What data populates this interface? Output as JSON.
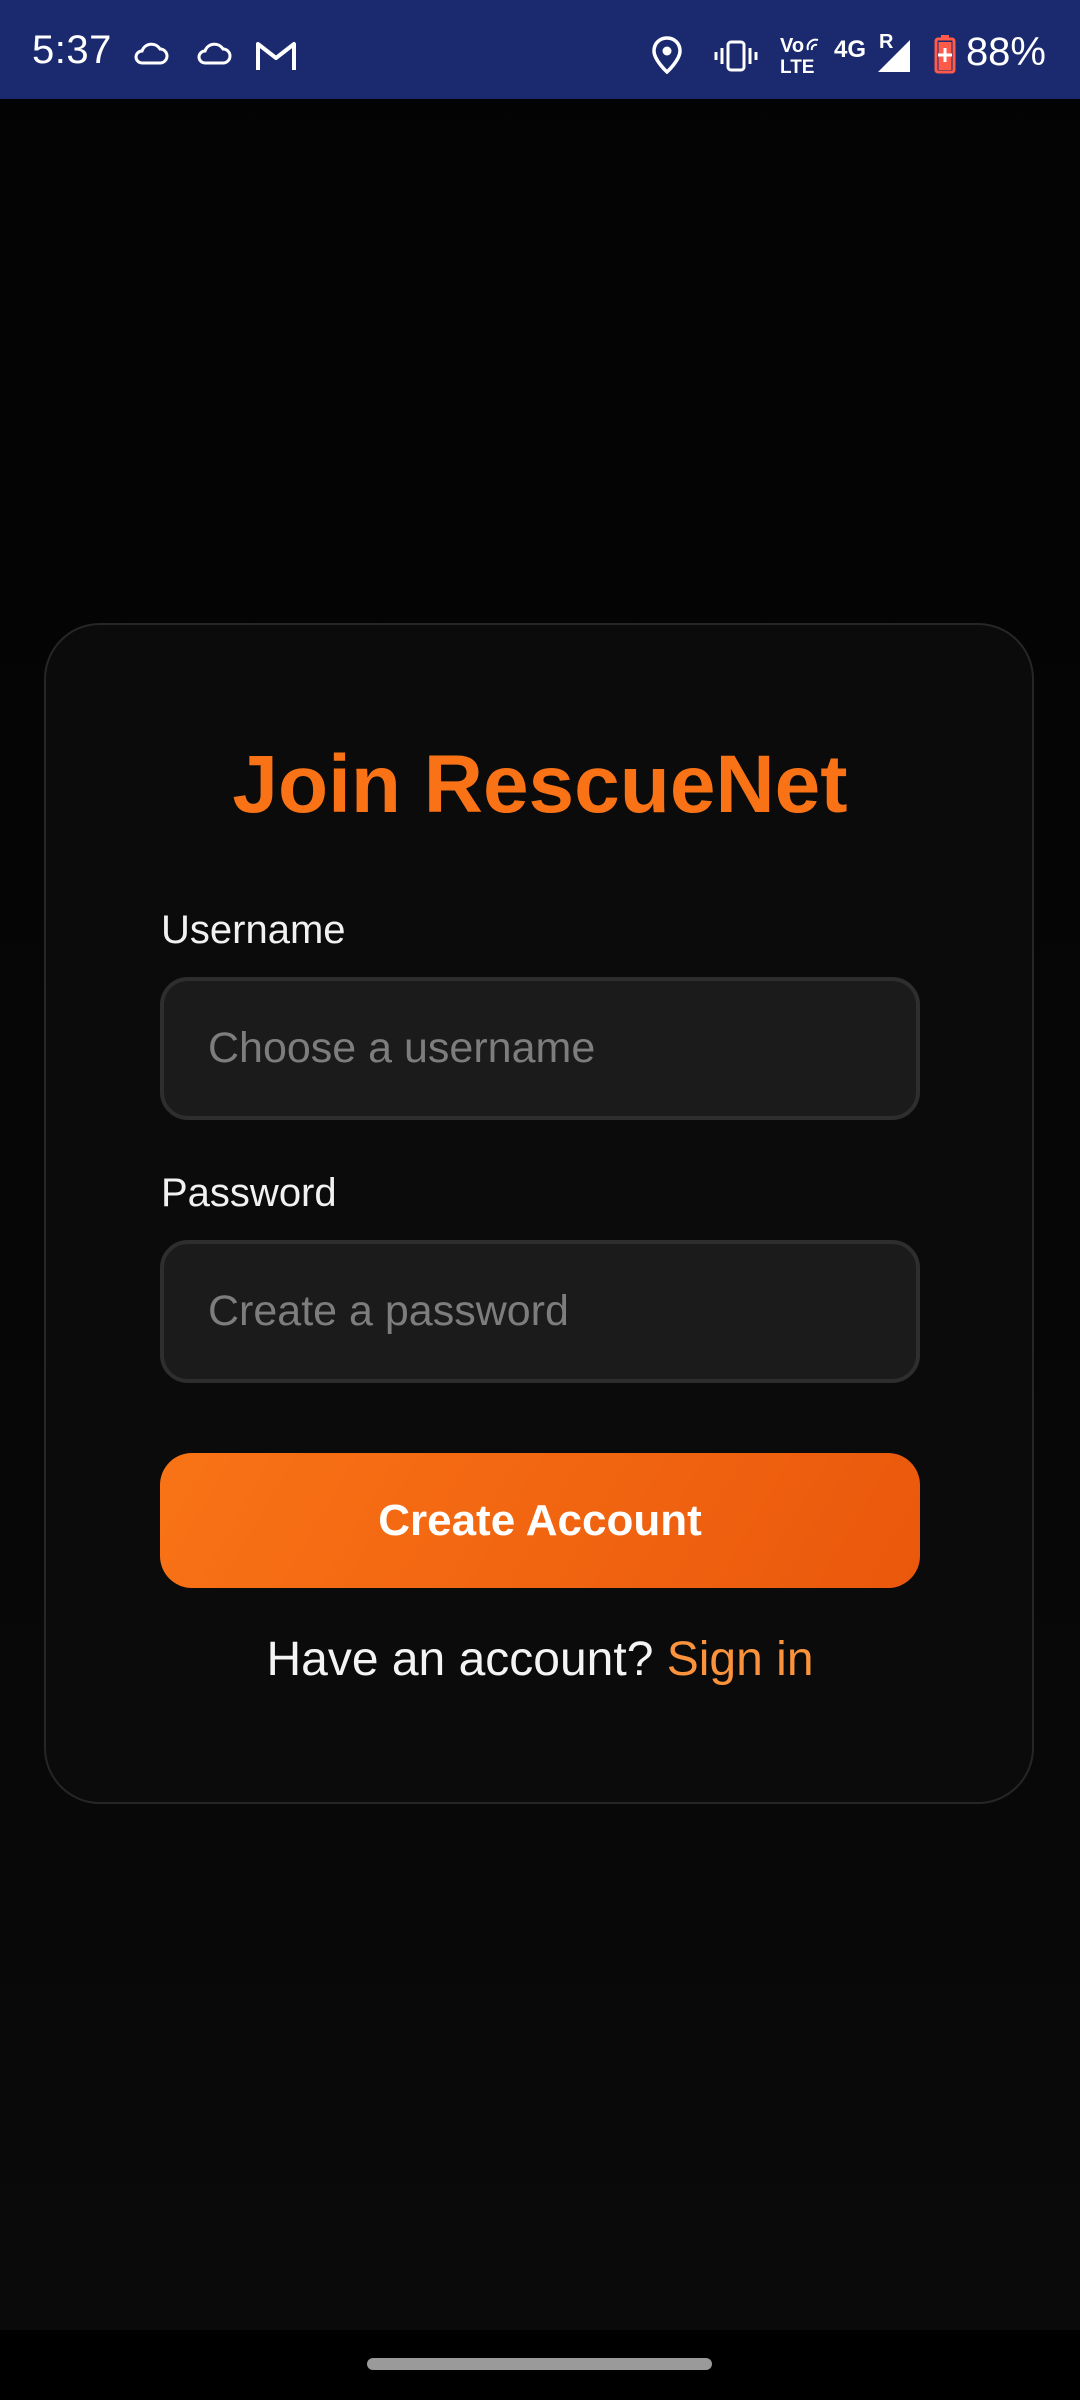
{
  "status_bar": {
    "time": "5:37",
    "left_icons": [
      "cloud-icon",
      "cloud-icon",
      "gmail-icon"
    ],
    "right_icons": [
      "location-icon",
      "vibrate-icon",
      "volte-icon",
      "signal-icon",
      "battery-icon"
    ],
    "volte_top": "Vo",
    "volte_bottom": "LTE",
    "network": "4G",
    "roaming": "R",
    "battery": "88%"
  },
  "signup": {
    "title": "Join RescueNet",
    "username_label": "Username",
    "username_placeholder": "Choose a username",
    "username_value": "",
    "password_label": "Password",
    "password_placeholder": "Create a password",
    "password_value": "",
    "submit_label": "Create Account",
    "signin_prompt": "Have an account?",
    "signin_link": "Sign in"
  },
  "colors": {
    "accent": "#f97316",
    "accent_dark": "#ea580c",
    "link": "#fb923c",
    "status_bar": "#1b2a6e",
    "background": "#050505",
    "card": "#0b0b0b",
    "input_bg": "#1b1b1b"
  }
}
